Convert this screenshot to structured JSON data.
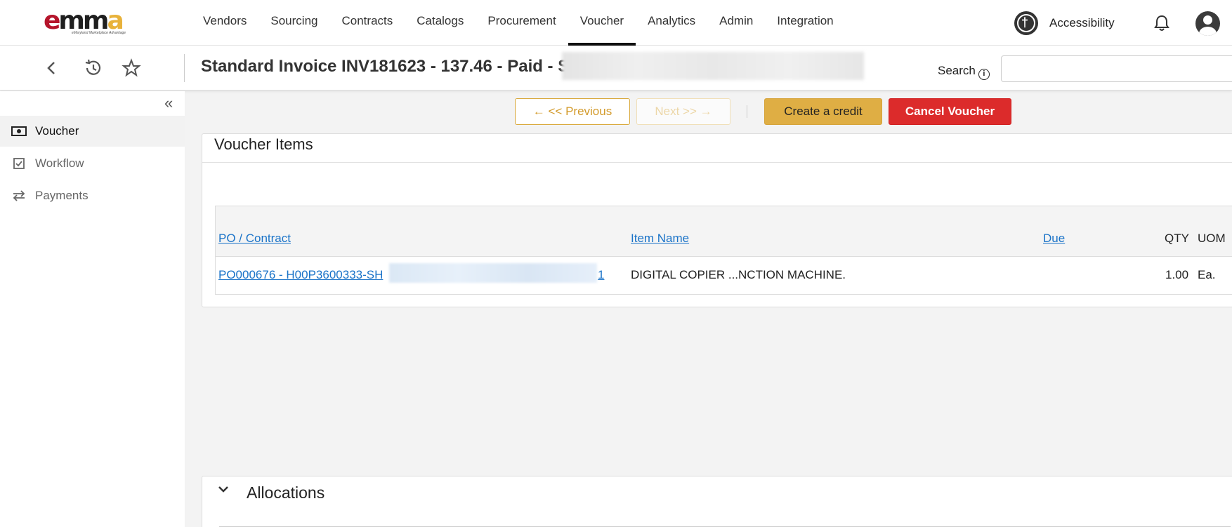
{
  "logo": {
    "e": "e",
    "mm": "mm",
    "a": "a",
    "tagline": "eMaryland Marketplace Advantage"
  },
  "nav": {
    "items": [
      {
        "label": "Vendors"
      },
      {
        "label": "Sourcing"
      },
      {
        "label": "Contracts"
      },
      {
        "label": "Catalogs"
      },
      {
        "label": "Procurement"
      },
      {
        "label": "Voucher"
      },
      {
        "label": "Analytics"
      },
      {
        "label": "Admin"
      },
      {
        "label": "Integration"
      }
    ],
    "active": "Voucher",
    "accessibility_label": "Accessibility"
  },
  "titlebar": {
    "title": "Standard Invoice INV181623 - 137.46 - Paid - S",
    "search_label": "Search",
    "search_value": ""
  },
  "sidebar": {
    "items": [
      {
        "label": "Voucher",
        "icon": "money-icon",
        "active": true
      },
      {
        "label": "Workflow",
        "icon": "checkbox-icon",
        "active": false
      },
      {
        "label": "Payments",
        "icon": "transfer-icon",
        "active": false
      }
    ]
  },
  "actions": {
    "previous": "← << Previous",
    "next": "Next >> →",
    "create_credit": "Create a credit",
    "cancel_voucher": "Cancel Voucher"
  },
  "voucher_items": {
    "title": "Voucher Items",
    "columns": {
      "po_contract": "PO / Contract",
      "item_name": "Item Name",
      "due": "Due",
      "qty": "QTY",
      "uom": "UOM"
    },
    "rows": [
      {
        "po_contract_prefix": "PO000676 - H00P3600333-SH",
        "po_contract_suffix": "1",
        "item_name": "DIGITAL COPIER ...NCTION MACHINE.",
        "due": "",
        "qty": "1.00",
        "uom": "Ea."
      }
    ]
  },
  "allocations": {
    "title": "Allocations"
  },
  "colors": {
    "accent_gold": "#dfae44",
    "danger_red": "#dc2b2b",
    "link_blue": "#1a73c8",
    "brand_red": "#b5152b"
  }
}
